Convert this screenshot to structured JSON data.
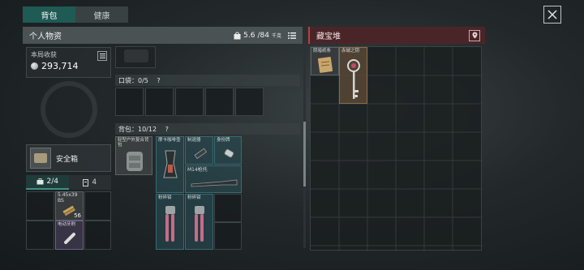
{
  "tabs": [
    {
      "label": "背包",
      "active": true
    },
    {
      "label": "健康",
      "active": false
    }
  ],
  "header": {
    "title": "个人物资",
    "weight_value": "5.6",
    "weight_max": "/84",
    "weight_unit": "千克"
  },
  "stash": {
    "title": "藏宝堆"
  },
  "earnings": {
    "label": "本局收获",
    "value": "293,714"
  },
  "safe": {
    "label": "安全箱"
  },
  "safe_tabs": [
    {
      "label": "2/4",
      "active": true
    },
    {
      "label": "4",
      "active": false
    }
  ],
  "pocket": {
    "label": "口袋：0/5",
    "help": "?"
  },
  "backpack": {
    "label": "背包：10/12",
    "help": "?"
  },
  "safe_items": [
    {
      "name": "5.45x39 BS",
      "count": "56"
    },
    {
      "name": "电动牙刷",
      "count": ""
    }
  ],
  "backpack_items": [
    {
      "name": "轻型户外复合背包",
      "name2": "",
      "count": ""
    },
    {
      "name": "摩卡咖啡壶",
      "count": ""
    },
    {
      "name": "制退器",
      "count": ""
    },
    {
      "name": "身份牌",
      "count": ""
    },
    {
      "name": "M14枪托",
      "count": ""
    },
    {
      "name": "粉碎钳",
      "count": ""
    },
    {
      "name": "粉碎钳",
      "count": ""
    }
  ],
  "stash_items": [
    {
      "name": "阴暗纸条"
    },
    {
      "name": "赤城之钥"
    }
  ],
  "colors": {
    "accent": "#1f5a55",
    "stash_accent": "#b8413e"
  }
}
